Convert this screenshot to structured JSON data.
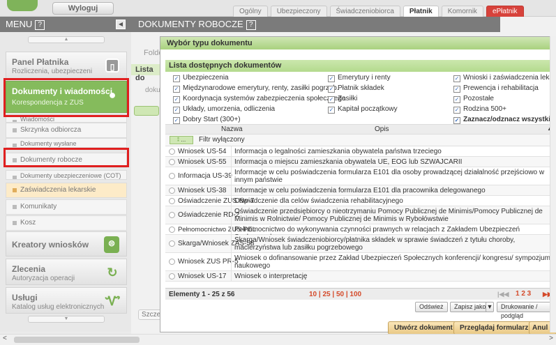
{
  "topbar": {
    "logout": "Wyloguj",
    "tabs": [
      "Ogólny",
      "Ubezpieczony",
      "Świadczeniobiorca",
      "Płatnik",
      "Komornik",
      "ePłatnik"
    ]
  },
  "menu": {
    "title": "MENU",
    "help": "?",
    "sections": [
      {
        "title": "Panel Płatnika",
        "sub": "Rozliczenia, ubezpieczeni"
      },
      {
        "title": "Dokumenty i wiadomości",
        "sub": "Korespondencja z ZUS"
      },
      {
        "title": "Kreatory wniosków",
        "sub": ""
      },
      {
        "title": "Zlecenia",
        "sub": "Autoryzacja operacji"
      },
      {
        "title": "Usługi",
        "sub": "Katalog usług elektronicznych"
      }
    ],
    "items": [
      "Wiadomości",
      "Skrzynka odbiorcza",
      "Dokumenty wysłane",
      "Dokumenty robocze",
      "Dokumenty ubezpieczeniowe (COT)",
      "Zaświadczenia lekarskie",
      "Komunikaty",
      "Kosz"
    ]
  },
  "main": {
    "header": "DOKUMENTY ROBOCZE",
    "folder_label": "Folde",
    "list_label": "Lista do",
    "doc_label": "doku",
    "szcz_label": "Szczeg"
  },
  "modal": {
    "title": "Wybór typu dokumentu",
    "list_title": "Lista dostępnych dokumentów",
    "checkboxes": [
      [
        "Ubezpieczenia",
        "Emerytury i renty",
        "Wnioski i zaświadczenia lekarskie"
      ],
      [
        "Międzynarodowe emerytury, renty, zasiłki pogrzeb.",
        "Płatnik składek",
        "Prewencja i rehabilitacja"
      ],
      [
        "Koordynacja systemów zabezpieczenia społecznego",
        "Zasiłki",
        "Pozostałe"
      ],
      [
        "Układy, umorzenia, odliczenia",
        "Kapitał początkowy",
        "Rodzina 500+"
      ],
      [
        "Dobry Start (300+)",
        "",
        ""
      ]
    ],
    "select_all": "Zaznacz/odznacz wszystkie",
    "columns": {
      "name": "Nazwa",
      "desc": "Opis"
    },
    "filter_btn": "...",
    "filter_label": "Filtr wyłączony",
    "rows": [
      {
        "name": "Wniosek US-54",
        "desc": "Informacja o legalności zamieszkania obywatela państwa trzeciego"
      },
      {
        "name": "Wniosek US-55",
        "desc": "Informacja o miejscu zamieszkania obywatela UE, EOG lub SZWAJCARII"
      },
      {
        "name": "Informacja US-39",
        "desc": "Informacje w celu poświadczenia formularza E101 dla osoby prowadzącej działalność przejściowo w innym państwie"
      },
      {
        "name": "Wniosek US-38",
        "desc": "Informacje w celu poświadczenia formularza E101 dla pracownika delegowanego"
      },
      {
        "name": "Oświadczenie ZUS Np-7",
        "desc": "Oświadczenie dla celów świadczenia rehabilitacyjnego"
      },
      {
        "name": "Oświadczenie RD-2",
        "desc": "Oświadczenie przedsiębiorcy o nieotrzymaniu Pomocy Publicznej de Minimis/Pomocy Publicznej de Minimis w Rolnictwie/ Pomocy Publicznej de Minimis w Rybołówstwie"
      },
      {
        "name": "Pełnomocnictwo ZUS-PEL",
        "desc": "Pełnomocnictwo do wykonywania czynności prawnych w relacjach z Zakładem Ubezpieczeń Społecznych"
      },
      {
        "name": "Skarga/Wniosek ZAS-58",
        "desc": "Skarga/Wniosek świadczeniobiorcy/płatnika składek w sprawie świadczeń z tytułu choroby, macierzyństwa lub zasiłku pogrzebowego"
      },
      {
        "name": "Wniosek ZUS PR-5",
        "desc": "Wniosek o dofinansowanie przez Zakład Ubezpieczeń Społecznych konferencji/ kongresu/ sympozjum naukowego"
      },
      {
        "name": "Wniosek US-17",
        "desc": "Wniosek o interpretację"
      }
    ],
    "footer": {
      "elements": "Elementy 1 - 25 z 56",
      "page_sizes": "10 | 25 | 50 | 100",
      "nav_first": "|◀◀",
      "pages": "1 2 3",
      "nav_last": "▶▶|"
    },
    "buttons": {
      "refresh": "Odśwież",
      "save_as": "Zapisz jako",
      "print": "Drukowanie / podgląd",
      "create": "Utwórz dokument",
      "browse": "Przeglądaj formularz",
      "cancel": "Anul"
    }
  }
}
